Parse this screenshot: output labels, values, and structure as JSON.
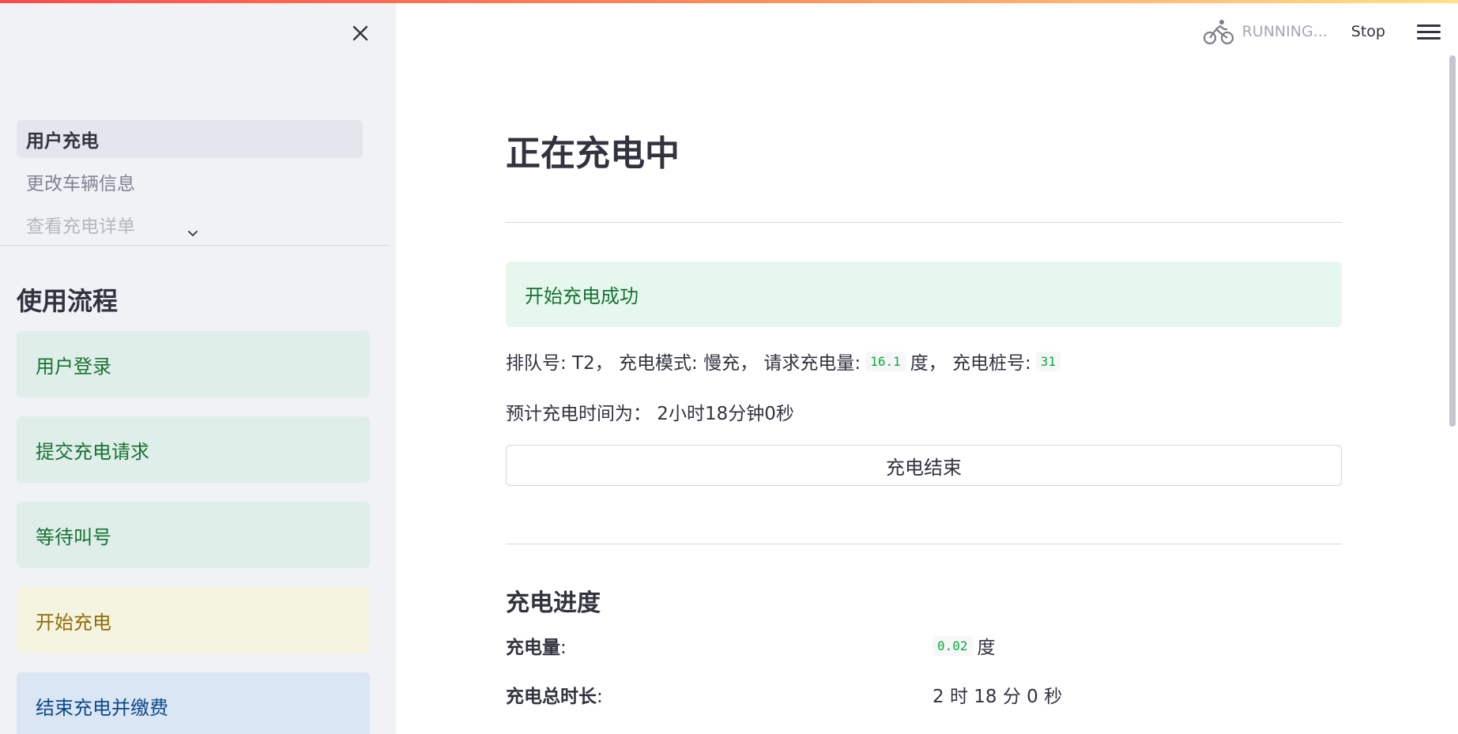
{
  "header": {
    "status_text": "RUNNING...",
    "stop_label": "Stop"
  },
  "sidebar": {
    "nav_items": [
      {
        "label": "用户充电"
      },
      {
        "label": "更改车辆信息"
      },
      {
        "label": "查看充电详单"
      }
    ],
    "flow_title": "使用流程",
    "flow_steps": [
      {
        "label": "用户登录"
      },
      {
        "label": "提交充电请求"
      },
      {
        "label": "等待叫号"
      },
      {
        "label": "开始充电"
      },
      {
        "label": "结束充电并缴费"
      }
    ]
  },
  "main": {
    "title": "正在充电中",
    "alert": "开始充电成功",
    "info": {
      "queue_label": "排队号: T2， 充电模式: 慢充， 请求充电量:",
      "requested_amount": "16.1",
      "unit_pile_label": "度， 充电桩号:",
      "pile_no": "31"
    },
    "eta": "预计充电时间为： 2小时18分钟0秒",
    "end_button": "充电结束",
    "progress_title": "充电进度",
    "rows": [
      {
        "label": "充电量",
        "colon": ":",
        "value": "0.02",
        "unit": "度"
      },
      {
        "label": "充电总时长",
        "colon": ":",
        "value": "2 时 18 分 0 秒"
      }
    ]
  },
  "colors": {
    "accent": "#ff4b4b",
    "success_bg": "#dfeee8",
    "success_text": "#177233",
    "warn_bg": "#f4f4e1",
    "info_bg": "#dbe6f4",
    "code_text": "#09ab3b"
  },
  "icons": {
    "close": "close-icon",
    "status": "bicycle-icon",
    "menu": "hamburger-menu-icon",
    "nav_more": "chevron-down-icon"
  }
}
